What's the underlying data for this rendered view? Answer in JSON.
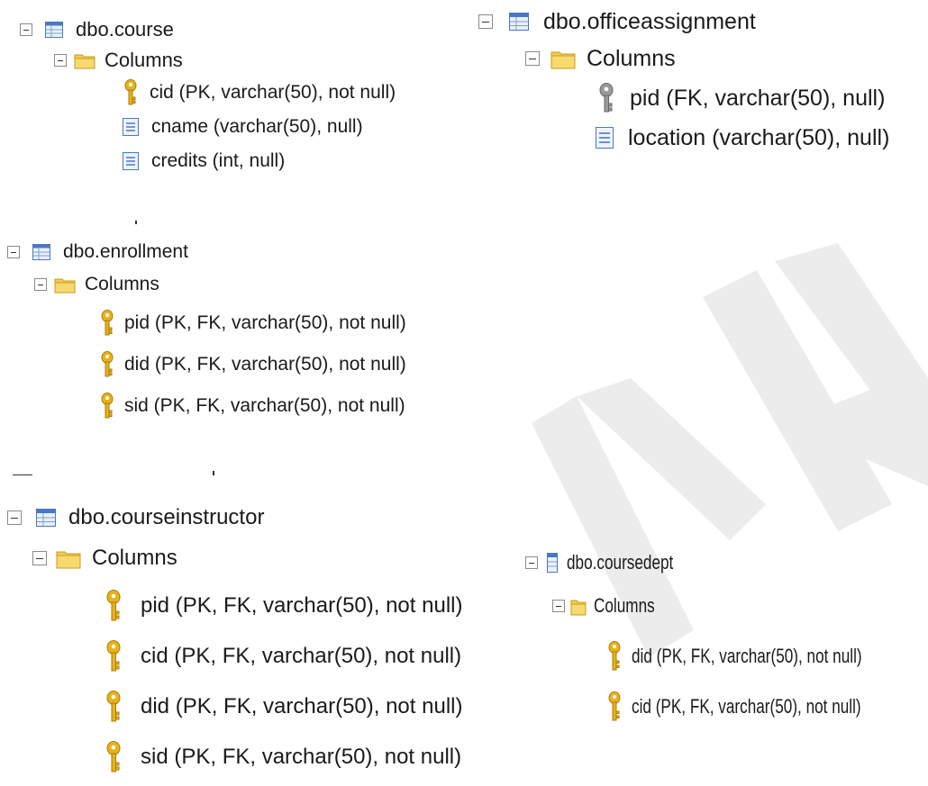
{
  "trees": {
    "course": {
      "table": "dbo.course",
      "folder": "Columns",
      "columns": [
        {
          "text": "cid (PK, varchar(50), not null)",
          "icon": "key-icon"
        },
        {
          "text": "cname (varchar(50), null)",
          "icon": "column-icon"
        },
        {
          "text": "credits (int, null)",
          "icon": "column-icon"
        }
      ]
    },
    "officeassignment": {
      "table": "dbo.officeassignment",
      "folder": "Columns",
      "columns": [
        {
          "text": "pid (FK, varchar(50), null)",
          "icon": "foreign-key-icon"
        },
        {
          "text": "location (varchar(50), null)",
          "icon": "column-icon"
        }
      ]
    },
    "enrollment": {
      "table": "dbo.enrollment",
      "folder": "Columns",
      "columns": [
        {
          "text": "pid (PK, FK, varchar(50), not null)",
          "icon": "key-icon"
        },
        {
          "text": "did (PK, FK, varchar(50), not null)",
          "icon": "key-icon"
        },
        {
          "text": "sid (PK, FK, varchar(50), not null)",
          "icon": "key-icon"
        }
      ]
    },
    "courseinstructor": {
      "table": "dbo.courseinstructor",
      "folder": "Columns",
      "columns": [
        {
          "text": "pid (PK, FK, varchar(50), not null)",
          "icon": "key-icon"
        },
        {
          "text": "cid (PK, FK, varchar(50), not null)",
          "icon": "key-icon"
        },
        {
          "text": "did (PK, FK, varchar(50), not null)",
          "icon": "key-icon"
        },
        {
          "text": "sid (PK, FK, varchar(50), not null)",
          "icon": "key-icon"
        }
      ]
    },
    "coursedept": {
      "table": "dbo.coursedept",
      "folder": "Columns",
      "columns": [
        {
          "text": "did (PK, FK, varchar(50), not null)",
          "icon": "key-icon"
        },
        {
          "text": "cid (PK, FK, varchar(50), not null)",
          "icon": "key-icon"
        }
      ]
    }
  },
  "colors": {
    "key_gold": "#e8b21a",
    "foreign_key_gray": "#9a9a9a",
    "folder_yellow": "#f2cb55",
    "table_blue": "#4a78c2",
    "watermark": "#dcdcdc"
  }
}
